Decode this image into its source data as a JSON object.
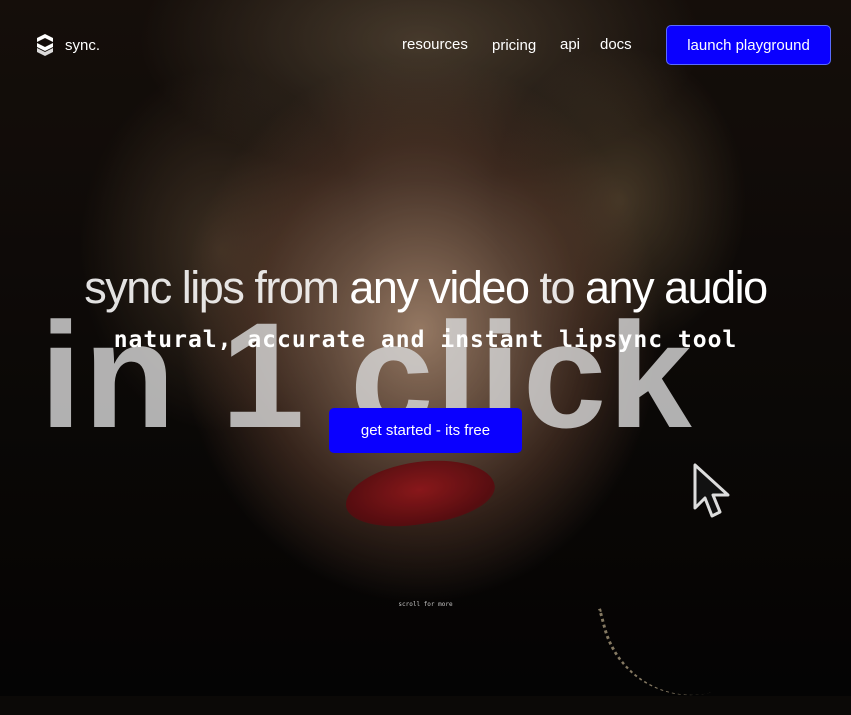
{
  "brand": {
    "name": "sync."
  },
  "nav": {
    "links": [
      {
        "label": "resources"
      },
      {
        "label": "pricing"
      },
      {
        "label": "api"
      },
      {
        "label": "docs"
      }
    ],
    "cta_label": "launch playground"
  },
  "hero": {
    "headline_part1": "sync lips from ",
    "headline_part2": "any video",
    "headline_part3": " to ",
    "headline_part4": "any audio",
    "background_text": "in 1 click",
    "subheadline": "natural, accurate and instant lipsync tool",
    "cta_label": "get started - its free",
    "scroll_hint": "scroll for more"
  },
  "colors": {
    "accent": "#0a00ff",
    "text": "#ffffff"
  },
  "icons": {
    "logo": "sync-logo-icon",
    "cursor": "mouse-pointer-icon"
  }
}
